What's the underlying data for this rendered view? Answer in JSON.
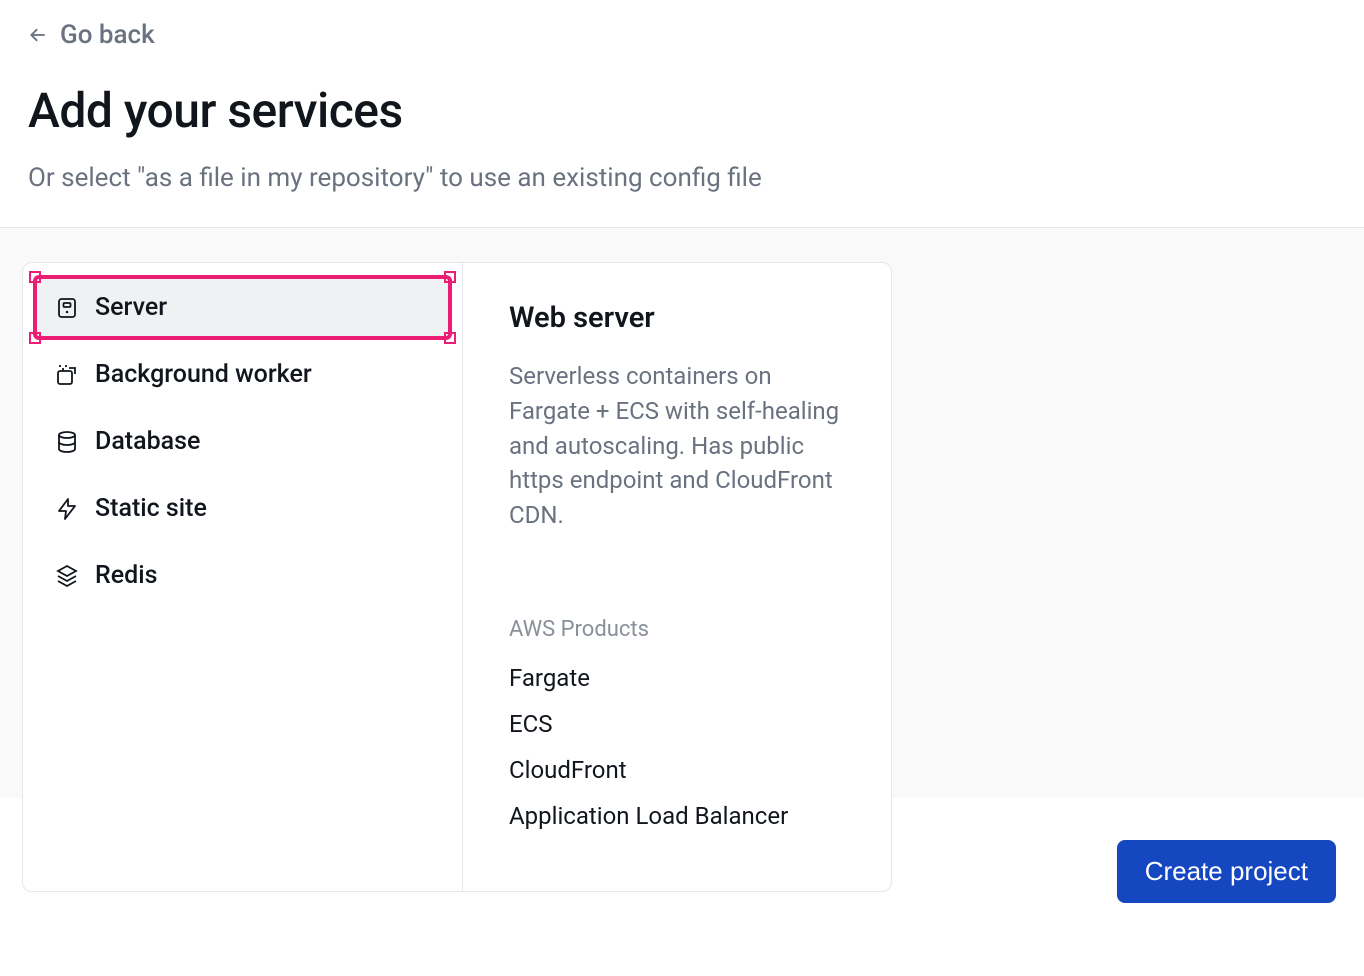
{
  "header": {
    "go_back": "Go back",
    "title": "Add your services",
    "subtitle": "Or select \"as a file in my repository\" to use an existing config file"
  },
  "services": [
    {
      "id": "server",
      "label": "Server",
      "icon": "server",
      "selected": true
    },
    {
      "id": "background-worker",
      "label": "Background worker",
      "icon": "worker",
      "selected": false
    },
    {
      "id": "database",
      "label": "Database",
      "icon": "database",
      "selected": false
    },
    {
      "id": "static-site",
      "label": "Static site",
      "icon": "lightning",
      "selected": false
    },
    {
      "id": "redis",
      "label": "Redis",
      "icon": "layers",
      "selected": false
    }
  ],
  "detail": {
    "title": "Web server",
    "description": "Serverless containers on Fargate + ECS with self-healing and autoscaling. Has public https endpoint and CloudFront CDN.",
    "aws_label": "AWS Products",
    "aws_products": [
      "Fargate",
      "ECS",
      "CloudFront",
      "Application Load Balancer"
    ]
  },
  "footer": {
    "create_label": "Create project"
  }
}
